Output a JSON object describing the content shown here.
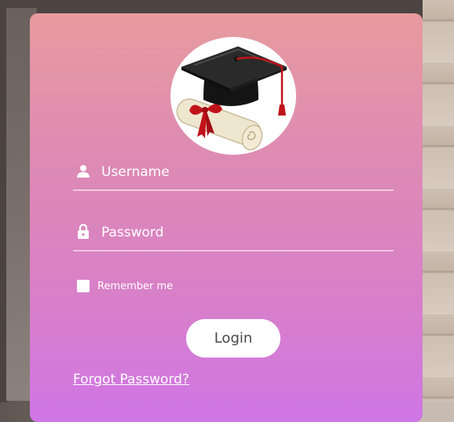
{
  "form": {
    "username_placeholder": "Username",
    "password_placeholder": "Password",
    "remember_label": "Remember me",
    "login_label": "Login",
    "forgot_label": "Forgot Password?"
  },
  "icons": {
    "avatar": "graduation-cap-and-diploma",
    "username": "person-icon",
    "password": "lock-icon"
  },
  "colors": {
    "card_top": "#e79b9e",
    "card_bottom": "#cf76e6",
    "text": "#ffffff",
    "button_bg": "#ffffff",
    "button_text": "#4a4a4a"
  }
}
